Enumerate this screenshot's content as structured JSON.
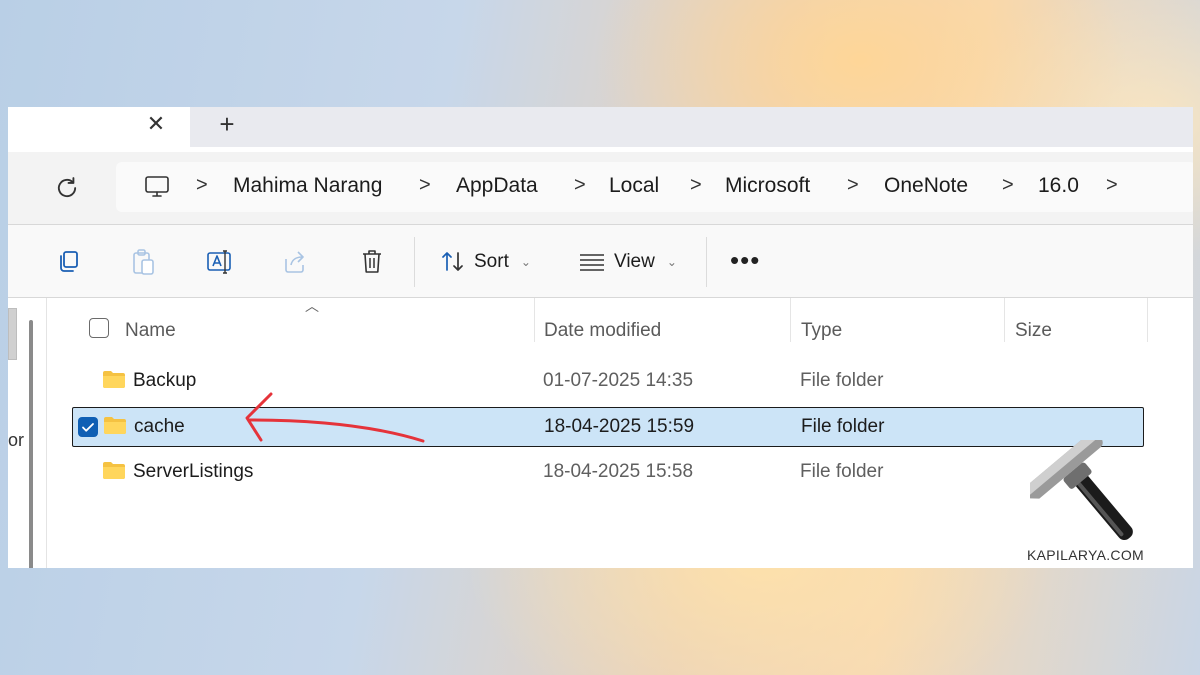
{
  "tabs": {
    "close_icon": "close-icon",
    "new_tab_icon": "plus-icon",
    "close_glyph": "✕",
    "new_glyph": "+"
  },
  "address": {
    "segments": [
      "Mahima Narang",
      "AppData",
      "Local",
      "Microsoft",
      "OneNote",
      "16.0"
    ],
    "separator": ">"
  },
  "toolbar": {
    "sort_label": "Sort",
    "view_label": "View",
    "more_label": "•••",
    "chevron": "⌄"
  },
  "columns": {
    "name": "Name",
    "date": "Date modified",
    "type": "Type",
    "size": "Size"
  },
  "rows": [
    {
      "name": "Backup",
      "date": "01-07-2025 14:35",
      "type": "File folder",
      "selected": false
    },
    {
      "name": "cache",
      "date": "18-04-2025 15:59",
      "type": "File folder",
      "selected": true
    },
    {
      "name": "ServerListings",
      "date": "18-04-2025 15:58",
      "type": "File folder",
      "selected": false
    }
  ],
  "nav_clip_text": "or",
  "watermark": "KAPILARYA.COM",
  "colors": {
    "selection": "#cce4f7",
    "accent": "#0f5fb4",
    "annotation_arrow": "#e5333a",
    "folder": "#f5c242"
  }
}
